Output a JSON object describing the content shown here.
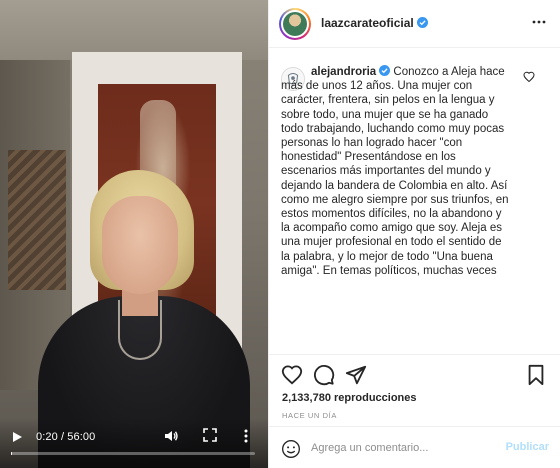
{
  "video": {
    "time_display": "0:20 / 56:00",
    "progress_fraction": 0.006
  },
  "post": {
    "username": "laazcarateoficial"
  },
  "comment": {
    "username": "alejandroria",
    "text": "Conozco a Aleja hace más de unos 12 años. Una mujer con carácter, frentera, sin pelos en la lengua y sobre todo, una mujer que se ha ganado todo trabajando, luchando como muy pocas personas lo han logrado hacer \"con honestidad\" Presentándose en los escenarios más importantes del mundo y dejando la bandera de Colombia en alto. Así como me alegro siempre por sus triunfos, en estos momentos difíciles, no la abandono y la acompaño como amigo que soy. Aleja es una mujer profesional en todo el sentido de la palabra, y lo mejor de todo \"Una buena amiga\". En temas políticos, muchas veces"
  },
  "stats": {
    "views": "2,133,780 reproducciones",
    "time_ago": "HACE UN DÍA"
  },
  "composer": {
    "placeholder": "Agrega un comentario...",
    "publish_label": "Publicar"
  },
  "colors": {
    "verified": "#3897f0",
    "publish_disabled": "#b2dffc"
  }
}
